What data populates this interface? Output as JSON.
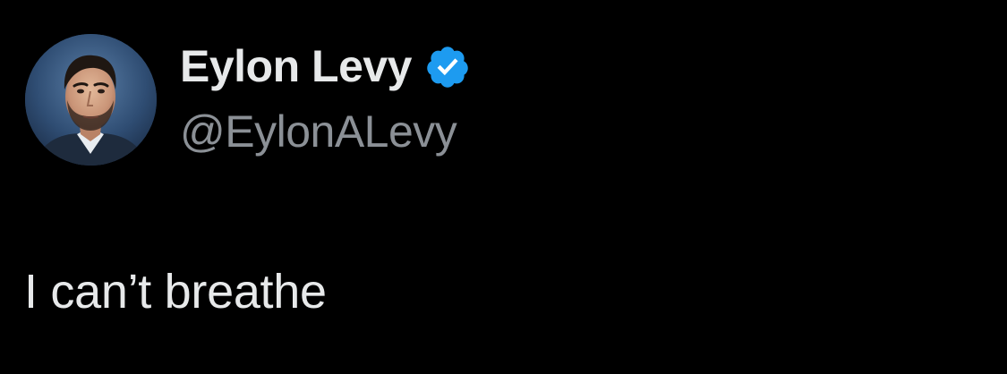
{
  "author": {
    "display_name": "Eylon Levy",
    "handle": "@EylonALevy",
    "verified": true,
    "avatar_icon": "profile-photo"
  },
  "tweet": {
    "text": "I can’t breathe"
  },
  "colors": {
    "background": "#000000",
    "primary_text": "#e7e9ea",
    "secondary_text": "#8b9096",
    "verified_badge": "#1d9bf0"
  }
}
